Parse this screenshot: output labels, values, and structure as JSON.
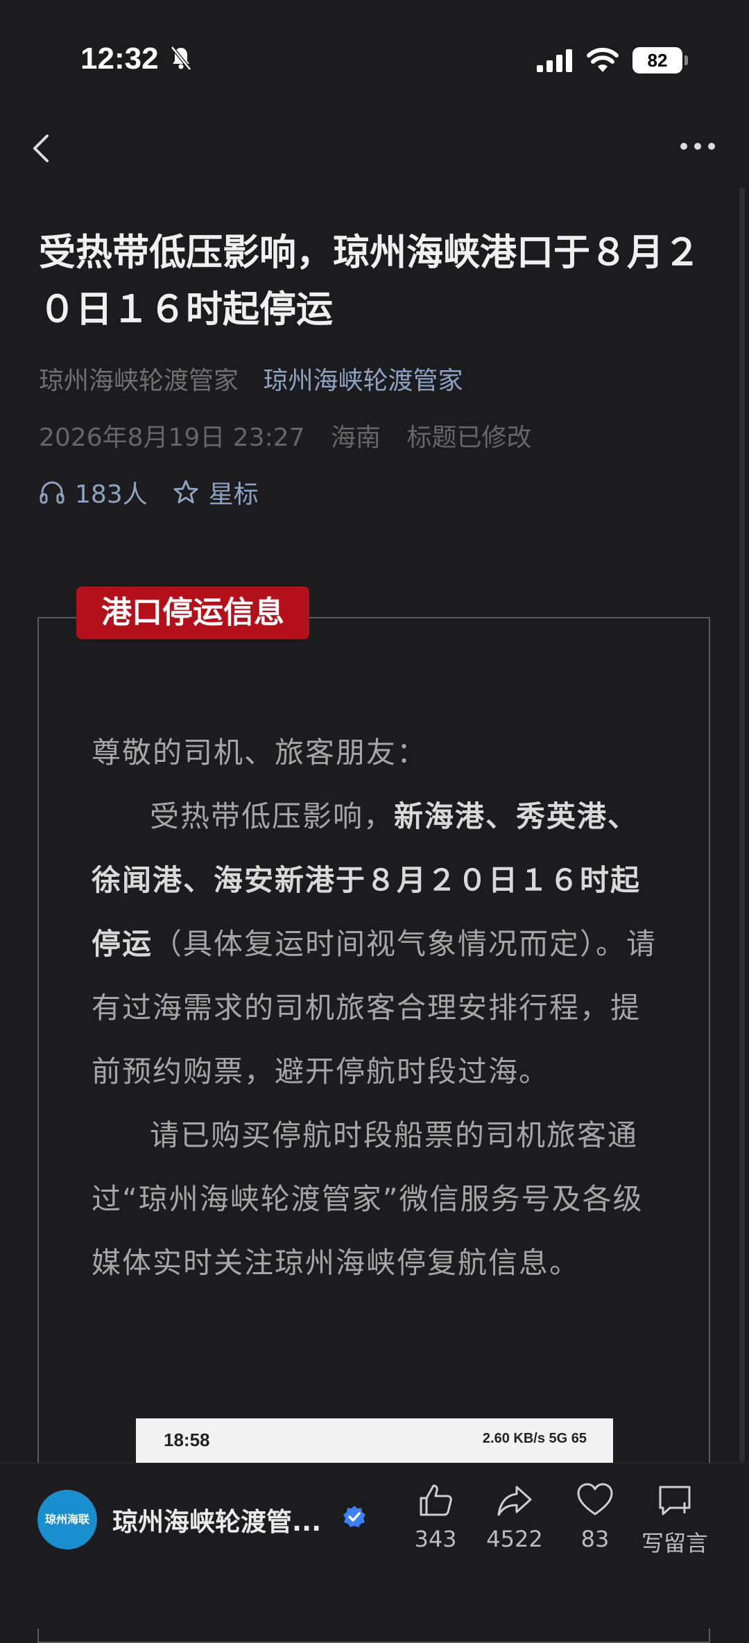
{
  "status_bar": {
    "time": "12:32",
    "battery": "82"
  },
  "article": {
    "title": "受热带低压影响，琼州海峡港口于８月２０日１６时起停运",
    "author": "琼州海峡轮渡管家",
    "account_link": "琼州海峡轮渡管家",
    "date": "2026年8月19日 23:27",
    "location": "海南",
    "title_modified": "标题已修改",
    "listeners": "183人",
    "star_label": "星标"
  },
  "notice": {
    "tag": "港口停运信息",
    "greeting": "尊敬的司机、旅客朋友：",
    "p1_normal_a": "受热带低压影响，",
    "p1_bold": "新海港、秀英港、徐闻港、海安新港于８月２０日１６时起停运",
    "p1_normal_b": "（具体复运时间视气象情况而定）。请有过海需求的司机旅客合理安排行程，提前预约购票，避开停航时段过海。",
    "p2": "请已购买停航时段船票的司机旅客通过“琼州海峡轮渡管家”微信服务号及各级媒体实时关注琼州海峡停复航信息。"
  },
  "embedded_screenshot": {
    "time": "18:58",
    "status": "2.60 KB/s 5G 65"
  },
  "bottom_bar": {
    "account_name": "琼州海峡轮渡管...",
    "logo_text": "琼州海联",
    "likes": "343",
    "shares": "4522",
    "hearts": "83",
    "comment_label": "写留言"
  },
  "colors": {
    "background": "#1c1c1e",
    "tag": "#b3101a",
    "link": "#8ea3c2",
    "verified": "#3b82f6"
  }
}
